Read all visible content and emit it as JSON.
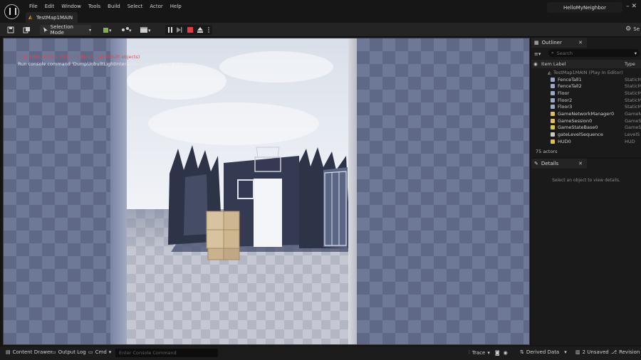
{
  "menu": [
    "File",
    "Edit",
    "Window",
    "Tools",
    "Build",
    "Select",
    "Actor",
    "Help"
  ],
  "map_tab": "TestMap1MAIN",
  "project_name": "HelloMyNeighbor",
  "window_controls": "– ✕",
  "toolbar": {
    "selection_mode": "Selection Mode",
    "settings": "Se"
  },
  "viewport": {
    "warning": "LIGHTING NEEDS TO BE REBUILT (14 unbuilt objects)",
    "hint": "Run console command 'DumpUnbuiltLightInteractions' to see what is unbuilt"
  },
  "outliner": {
    "tab": "Outliner",
    "search_placeholder": "Search",
    "col_label": "Item Label",
    "col_type": "Type",
    "root": "TestMap1MAIN (Play In Editor)",
    "items": [
      {
        "name": "FenceTall1",
        "type": "StaticM",
        "color": "#9aa7c7"
      },
      {
        "name": "FenceTall2",
        "type": "StaticM",
        "color": "#9aa7c7"
      },
      {
        "name": "Floor",
        "type": "StaticM",
        "color": "#9aa7c7"
      },
      {
        "name": "Floor2",
        "type": "StaticM",
        "color": "#9aa7c7"
      },
      {
        "name": "Floor3",
        "type": "StaticM",
        "color": "#9aa7c7"
      },
      {
        "name": "GameNetworkManager0",
        "type": "GameN",
        "color": "#e0c24a"
      },
      {
        "name": "GameSession0",
        "type": "GameS",
        "color": "#e0c24a"
      },
      {
        "name": "GameStateBase0",
        "type": "GameS",
        "color": "#e0c24a"
      },
      {
        "name": "gateLevelSequence",
        "type": "LevelS",
        "color": "#c9c9c9"
      },
      {
        "name": "HUD0",
        "type": "HUD",
        "color": "#e0c24a"
      }
    ],
    "actor_count": "75 actors"
  },
  "details": {
    "tab": "Details",
    "empty": "Select an object to view details."
  },
  "statusbar": {
    "content_drawer": "Content Drawer",
    "output_log": "Output Log",
    "cmd": "Cmd",
    "console_placeholder": "Enter Console Command",
    "trace": "Trace",
    "derived_data": "Derived Data",
    "unsaved": "2 Unsaved",
    "revision": "Revision C"
  }
}
